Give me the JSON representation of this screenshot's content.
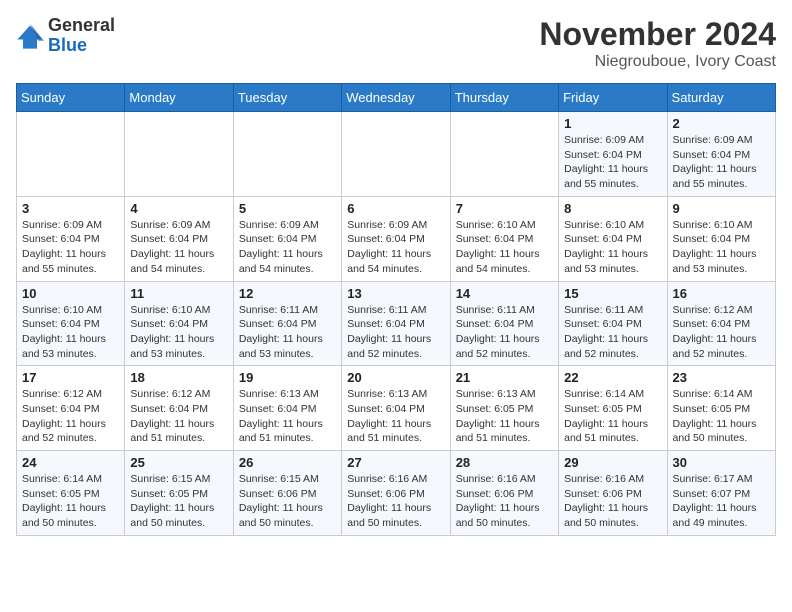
{
  "header": {
    "logo_general": "General",
    "logo_blue": "Blue",
    "month": "November 2024",
    "location": "Niegrouboue, Ivory Coast"
  },
  "days_of_week": [
    "Sunday",
    "Monday",
    "Tuesday",
    "Wednesday",
    "Thursday",
    "Friday",
    "Saturday"
  ],
  "weeks": [
    [
      {
        "day": "",
        "info": ""
      },
      {
        "day": "",
        "info": ""
      },
      {
        "day": "",
        "info": ""
      },
      {
        "day": "",
        "info": ""
      },
      {
        "day": "",
        "info": ""
      },
      {
        "day": "1",
        "info": "Sunrise: 6:09 AM\nSunset: 6:04 PM\nDaylight: 11 hours\nand 55 minutes."
      },
      {
        "day": "2",
        "info": "Sunrise: 6:09 AM\nSunset: 6:04 PM\nDaylight: 11 hours\nand 55 minutes."
      }
    ],
    [
      {
        "day": "3",
        "info": "Sunrise: 6:09 AM\nSunset: 6:04 PM\nDaylight: 11 hours\nand 55 minutes."
      },
      {
        "day": "4",
        "info": "Sunrise: 6:09 AM\nSunset: 6:04 PM\nDaylight: 11 hours\nand 54 minutes."
      },
      {
        "day": "5",
        "info": "Sunrise: 6:09 AM\nSunset: 6:04 PM\nDaylight: 11 hours\nand 54 minutes."
      },
      {
        "day": "6",
        "info": "Sunrise: 6:09 AM\nSunset: 6:04 PM\nDaylight: 11 hours\nand 54 minutes."
      },
      {
        "day": "7",
        "info": "Sunrise: 6:10 AM\nSunset: 6:04 PM\nDaylight: 11 hours\nand 54 minutes."
      },
      {
        "day": "8",
        "info": "Sunrise: 6:10 AM\nSunset: 6:04 PM\nDaylight: 11 hours\nand 53 minutes."
      },
      {
        "day": "9",
        "info": "Sunrise: 6:10 AM\nSunset: 6:04 PM\nDaylight: 11 hours\nand 53 minutes."
      }
    ],
    [
      {
        "day": "10",
        "info": "Sunrise: 6:10 AM\nSunset: 6:04 PM\nDaylight: 11 hours\nand 53 minutes."
      },
      {
        "day": "11",
        "info": "Sunrise: 6:10 AM\nSunset: 6:04 PM\nDaylight: 11 hours\nand 53 minutes."
      },
      {
        "day": "12",
        "info": "Sunrise: 6:11 AM\nSunset: 6:04 PM\nDaylight: 11 hours\nand 53 minutes."
      },
      {
        "day": "13",
        "info": "Sunrise: 6:11 AM\nSunset: 6:04 PM\nDaylight: 11 hours\nand 52 minutes."
      },
      {
        "day": "14",
        "info": "Sunrise: 6:11 AM\nSunset: 6:04 PM\nDaylight: 11 hours\nand 52 minutes."
      },
      {
        "day": "15",
        "info": "Sunrise: 6:11 AM\nSunset: 6:04 PM\nDaylight: 11 hours\nand 52 minutes."
      },
      {
        "day": "16",
        "info": "Sunrise: 6:12 AM\nSunset: 6:04 PM\nDaylight: 11 hours\nand 52 minutes."
      }
    ],
    [
      {
        "day": "17",
        "info": "Sunrise: 6:12 AM\nSunset: 6:04 PM\nDaylight: 11 hours\nand 52 minutes."
      },
      {
        "day": "18",
        "info": "Sunrise: 6:12 AM\nSunset: 6:04 PM\nDaylight: 11 hours\nand 51 minutes."
      },
      {
        "day": "19",
        "info": "Sunrise: 6:13 AM\nSunset: 6:04 PM\nDaylight: 11 hours\nand 51 minutes."
      },
      {
        "day": "20",
        "info": "Sunrise: 6:13 AM\nSunset: 6:04 PM\nDaylight: 11 hours\nand 51 minutes."
      },
      {
        "day": "21",
        "info": "Sunrise: 6:13 AM\nSunset: 6:05 PM\nDaylight: 11 hours\nand 51 minutes."
      },
      {
        "day": "22",
        "info": "Sunrise: 6:14 AM\nSunset: 6:05 PM\nDaylight: 11 hours\nand 51 minutes."
      },
      {
        "day": "23",
        "info": "Sunrise: 6:14 AM\nSunset: 6:05 PM\nDaylight: 11 hours\nand 50 minutes."
      }
    ],
    [
      {
        "day": "24",
        "info": "Sunrise: 6:14 AM\nSunset: 6:05 PM\nDaylight: 11 hours\nand 50 minutes."
      },
      {
        "day": "25",
        "info": "Sunrise: 6:15 AM\nSunset: 6:05 PM\nDaylight: 11 hours\nand 50 minutes."
      },
      {
        "day": "26",
        "info": "Sunrise: 6:15 AM\nSunset: 6:06 PM\nDaylight: 11 hours\nand 50 minutes."
      },
      {
        "day": "27",
        "info": "Sunrise: 6:16 AM\nSunset: 6:06 PM\nDaylight: 11 hours\nand 50 minutes."
      },
      {
        "day": "28",
        "info": "Sunrise: 6:16 AM\nSunset: 6:06 PM\nDaylight: 11 hours\nand 50 minutes."
      },
      {
        "day": "29",
        "info": "Sunrise: 6:16 AM\nSunset: 6:06 PM\nDaylight: 11 hours\nand 50 minutes."
      },
      {
        "day": "30",
        "info": "Sunrise: 6:17 AM\nSunset: 6:07 PM\nDaylight: 11 hours\nand 49 minutes."
      }
    ]
  ]
}
